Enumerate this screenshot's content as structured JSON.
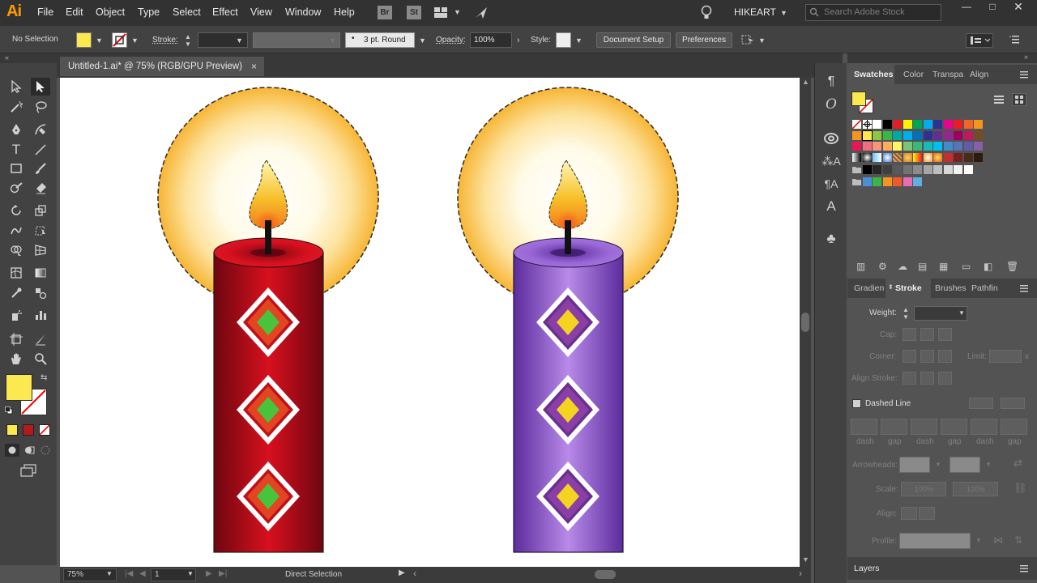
{
  "app": {
    "logo": "Ai",
    "menu": [
      "File",
      "Edit",
      "Object",
      "Type",
      "Select",
      "Effect",
      "View",
      "Window",
      "Help"
    ],
    "bridge_badge": "Br",
    "stock_badge": "St",
    "workspace": "HIKEART",
    "search_placeholder": "Search Adobe Stock"
  },
  "control_bar": {
    "selection_state": "No Selection",
    "stroke_label": "Stroke:",
    "brush_value": "3 pt. Round",
    "opacity_label": "Opacity:",
    "opacity_value": "100%",
    "style_label": "Style:",
    "document_setup": "Document Setup",
    "preferences": "Preferences"
  },
  "document_tab": {
    "title": "Untitled-1.ai* @ 75% (RGB/GPU Preview)",
    "close": "×"
  },
  "status_bar": {
    "zoom": "75%",
    "artboard_number": "1",
    "tool_name": "Direct Selection"
  },
  "swatches_panel": {
    "tabs": [
      "Swatches",
      "Color",
      "Transpa",
      "Align"
    ],
    "active_tab": "Swatches"
  },
  "stroke_panel": {
    "tabs": [
      "Gradien",
      "Stroke",
      "Brushes",
      "Pathfin"
    ],
    "active_tab": "Stroke",
    "weight_label": "Weight:",
    "cap_label": "Cap:",
    "corner_label": "Corner:",
    "limit_label": "Limit:",
    "limit_unit": "x",
    "align_label": "Align Stroke:",
    "dashed_line_label": "Dashed Line",
    "dash_labels": [
      "dash",
      "gap",
      "dash",
      "gap",
      "dash",
      "gap"
    ],
    "arrowheads_label": "Arrowheads:",
    "scale_label": "Scale:",
    "scale_values": [
      "100%",
      "100%"
    ],
    "align_arrow_label": "Align:",
    "profile_label": "Profile:"
  },
  "layers_panel": {
    "title": "Layers"
  },
  "colors": {
    "fill": "#fce94f",
    "accent_orange": "#ff9a00",
    "red_candle": "#c90d1f",
    "purple_candle": "#8e59c9"
  },
  "icons": {
    "toolbar": [
      "selection-icon",
      "direct-selection-icon",
      "magic-wand-icon",
      "lasso-icon",
      "pen-icon",
      "curvature-icon",
      "type-icon",
      "line-icon",
      "rectangle-icon",
      "paintbrush-icon",
      "shaper-icon",
      "eraser-icon",
      "rotate-icon",
      "scale-icon",
      "warp-icon",
      "free-transform-icon",
      "shape-builder-icon",
      "perspective-icon",
      "mesh-icon",
      "gradient-icon",
      "eyedropper-icon",
      "blend-icon",
      "symbol-sprayer-icon",
      "graph-icon",
      "artboard-icon",
      "slice-icon",
      "hand-icon",
      "zoom-icon"
    ]
  }
}
